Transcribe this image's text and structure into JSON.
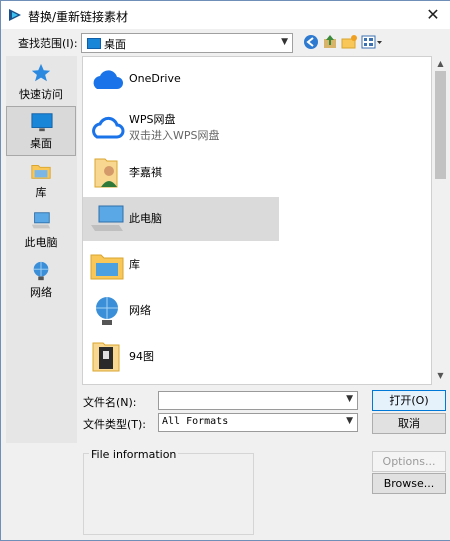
{
  "window": {
    "title": "替换/重新链接素材",
    "close_glyph": "✕"
  },
  "lookin": {
    "label": "查找范围(I):",
    "value": "桌面"
  },
  "places": [
    {
      "label": "快速访问",
      "icon": "star-icon"
    },
    {
      "label": "桌面",
      "icon": "desktop-icon",
      "selected": true
    },
    {
      "label": "库",
      "icon": "library-icon"
    },
    {
      "label": "此电脑",
      "icon": "computer-icon"
    },
    {
      "label": "网络",
      "icon": "network-icon"
    }
  ],
  "files": [
    {
      "name": "OneDrive",
      "icon": "cloud-icon"
    },
    {
      "name": "WPS网盘",
      "sub": "双击进入WPS网盘",
      "icon": "cloud-outline-icon"
    },
    {
      "name": "李嘉祺",
      "icon": "user-folder-icon"
    },
    {
      "name": "此电脑",
      "icon": "computer-icon",
      "selected": true
    },
    {
      "name": "库",
      "icon": "library-icon"
    },
    {
      "name": "网络",
      "icon": "network-icon"
    },
    {
      "name": "94图",
      "icon": "image-folder-icon"
    }
  ],
  "filename": {
    "label": "文件名(N):",
    "value": ""
  },
  "filetype": {
    "label": "文件类型(T):",
    "value": "All Formats"
  },
  "buttons": {
    "open": "打开(O)",
    "cancel": "取消",
    "options": "Options...",
    "browse": "Browse..."
  },
  "fileinfo": {
    "label": "File information"
  },
  "colors": {
    "accent": "#0078d7",
    "folder": "#f8c758",
    "cloud": "#1a73e8"
  }
}
